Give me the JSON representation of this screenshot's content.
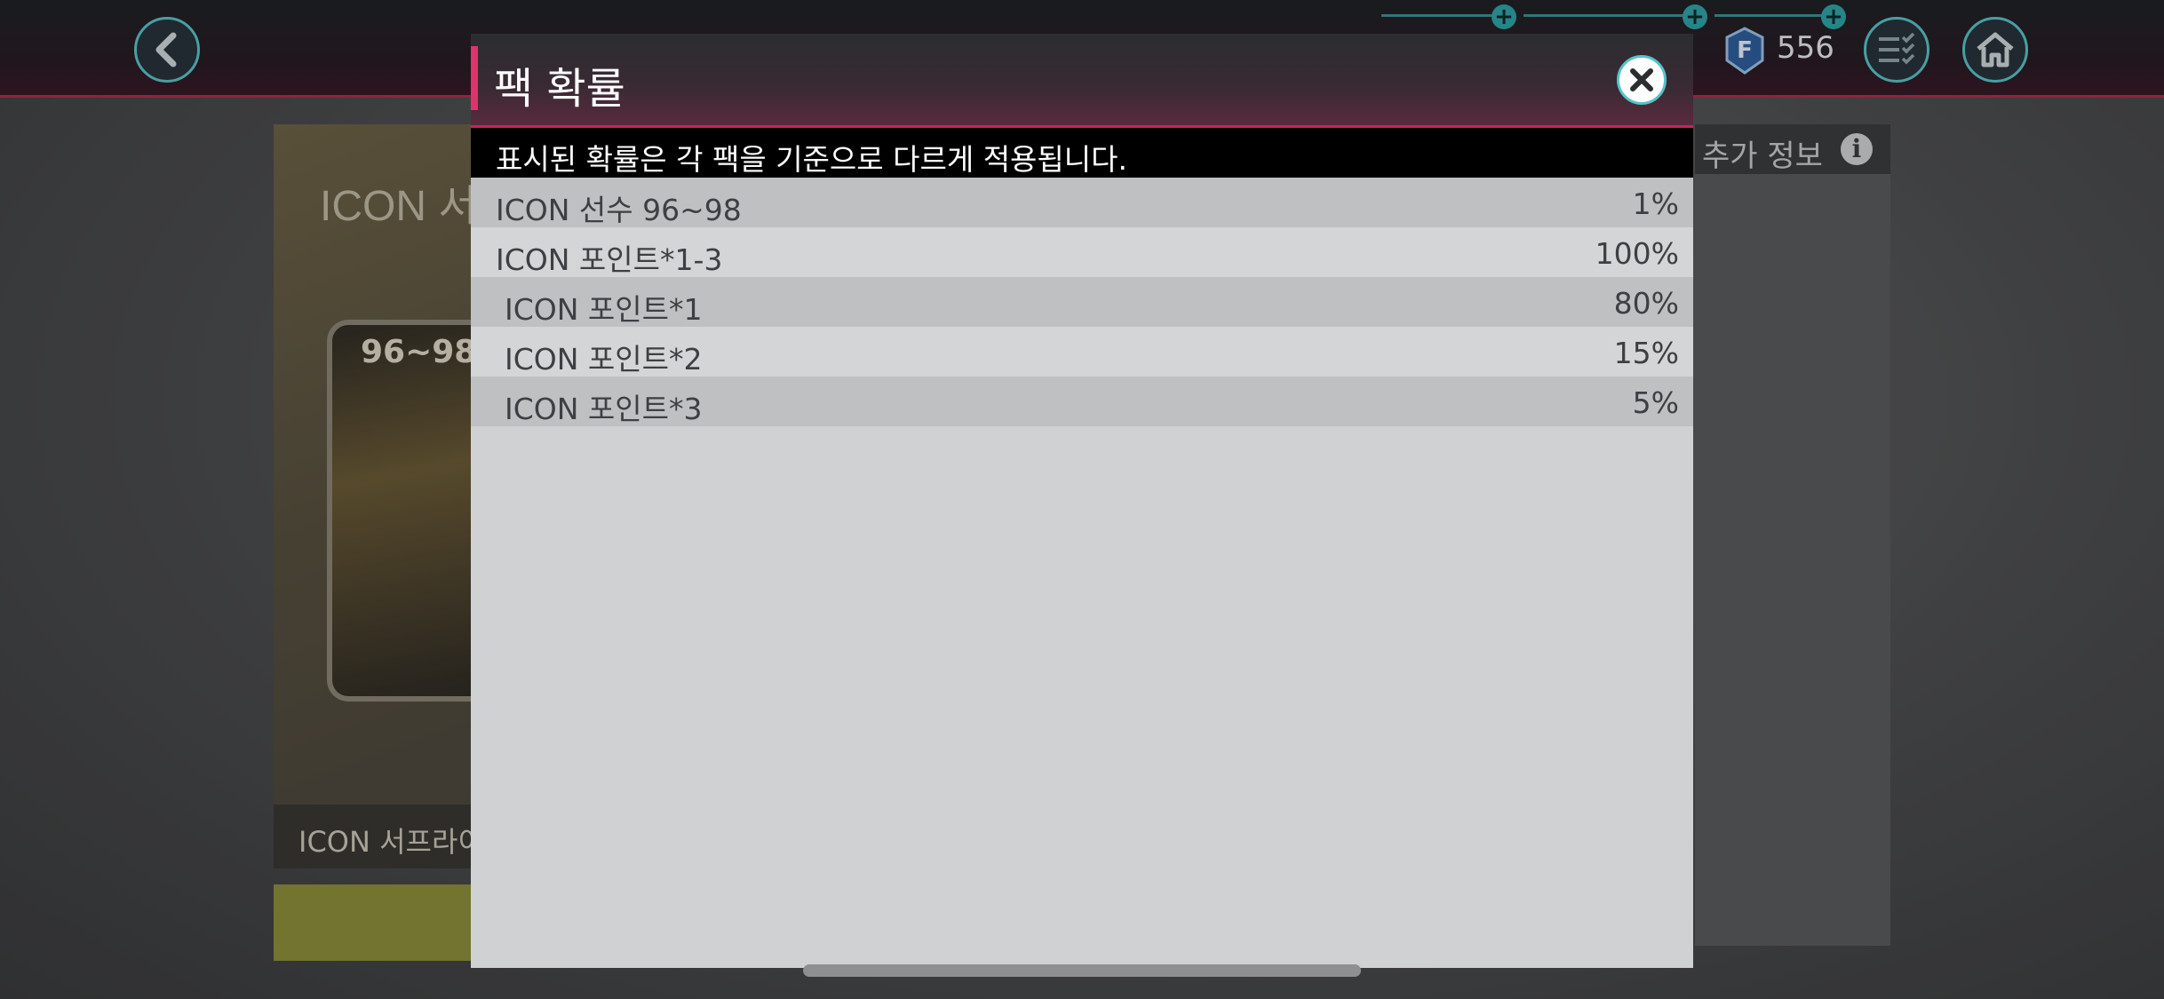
{
  "topbar": {
    "fifa_points": "556",
    "fifa_icon_letter": "F"
  },
  "background": {
    "pack_title": "ICON 서",
    "pack_rating": "96~98",
    "pack_footer": "ICON 서프라이",
    "extra_info_label": "추가 정보",
    "info_icon_glyph": "i"
  },
  "modal": {
    "title": "팩 확률",
    "notice": "표시된 확률은 각 팩을 기준으로 다르게 적용됩니다.",
    "rows": [
      {
        "name": "ICON 선수 96~98",
        "value": "1%"
      },
      {
        "name": "ICON 포인트*1-3",
        "value": "100%"
      },
      {
        "name": "ICON 포인트*1",
        "value": "80%"
      },
      {
        "name": "ICON 포인트*2",
        "value": "15%"
      },
      {
        "name": "ICON 포인트*3",
        "value": "5%"
      }
    ]
  },
  "colors": {
    "accent_pink": "#e0336b",
    "accent_teal": "#55c3c9",
    "notice_bg": "#000000"
  },
  "icons": [
    "back-arrow-icon",
    "plus-icon",
    "fifa-points-icon",
    "checklist-menu-icon",
    "home-icon",
    "close-icon",
    "info-icon"
  ]
}
